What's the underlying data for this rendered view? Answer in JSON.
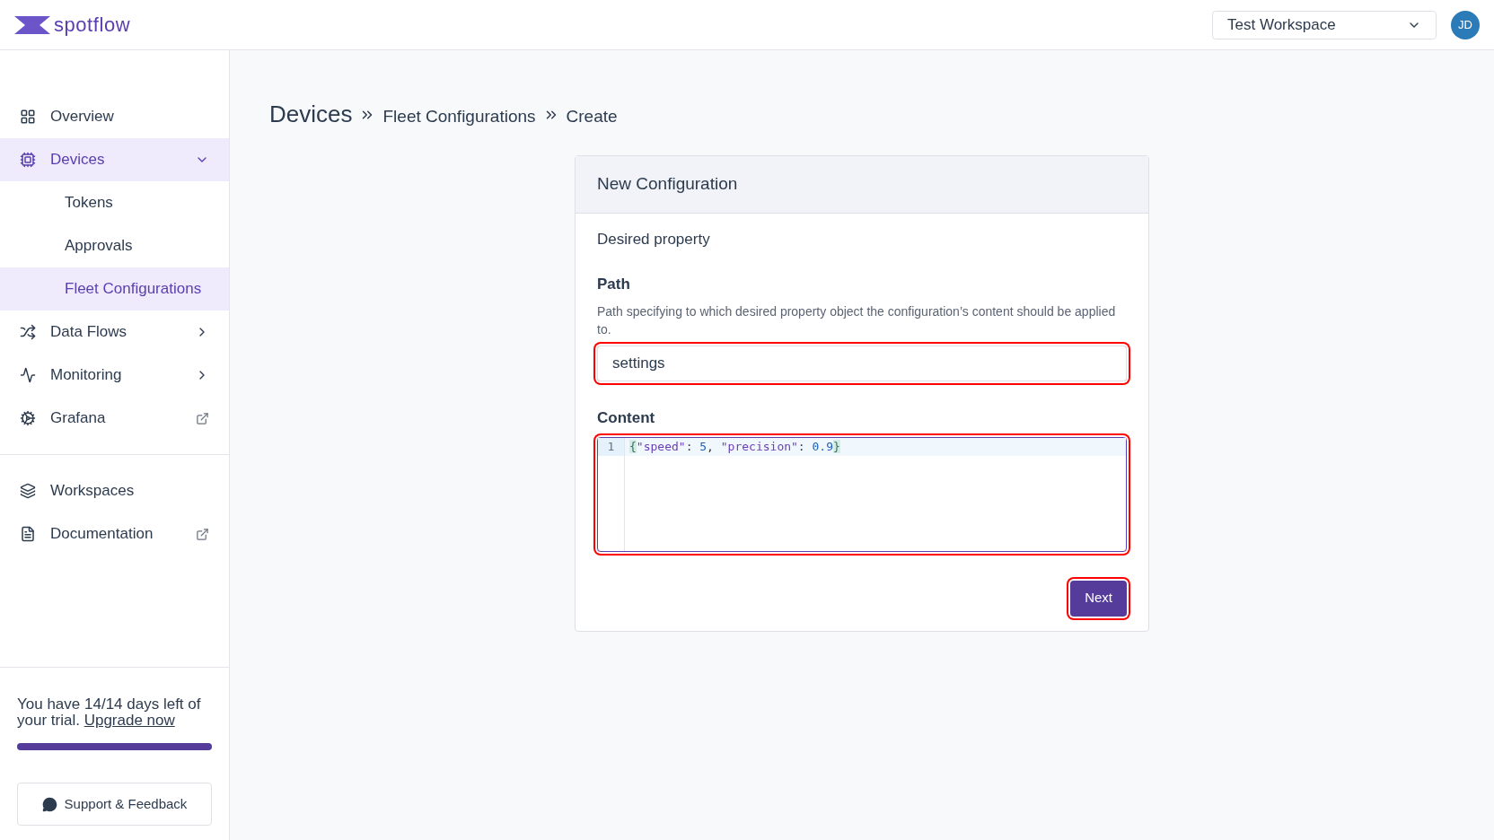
{
  "header": {
    "logo": "spotflow",
    "workspace": "Test Workspace",
    "avatar": "JD"
  },
  "sidebar": {
    "items": [
      {
        "label": "Overview",
        "kind": "link",
        "selected": false
      },
      {
        "label": "Devices",
        "kind": "group",
        "selected": true,
        "expanded": true,
        "children": [
          {
            "label": "Tokens",
            "selected": false
          },
          {
            "label": "Approvals",
            "selected": false
          },
          {
            "label": "Fleet Configurations",
            "selected": true
          }
        ]
      },
      {
        "label": "Data Flows",
        "kind": "group",
        "selected": false,
        "expanded": false
      },
      {
        "label": "Monitoring",
        "kind": "group",
        "selected": false,
        "expanded": false
      },
      {
        "label": "Grafana",
        "kind": "external",
        "selected": false
      }
    ],
    "bottom_items": [
      {
        "label": "Workspaces",
        "kind": "link",
        "selected": false
      },
      {
        "label": "Documentation",
        "kind": "external",
        "selected": false
      }
    ],
    "trial": {
      "text": "You have 14/14 days left of your trial.",
      "link": "Upgrade now",
      "level": 1
    },
    "support": "Support & Feedback"
  },
  "breadcrumb": [
    {
      "label": "Devices"
    },
    {
      "label": "Fleet Configurations"
    },
    {
      "label": "Create"
    }
  ],
  "card": {
    "title": "New Configuration",
    "section": "Desired property",
    "path": {
      "label": "Path",
      "hint": "Path specifying to which desired property object the configuration’s content should be applied to.",
      "value": "settings",
      "highlighted": true
    },
    "content": {
      "label": "Content",
      "highlighted": true,
      "lines": [
        {
          "number": "1",
          "tokens": [
            {
              "text": "{",
              "kind": "bracket"
            },
            {
              "text": "\"speed\"",
              "kind": "key"
            },
            {
              "text": ": ",
              "kind": "punct"
            },
            {
              "text": "5",
              "kind": "number"
            },
            {
              "text": ", ",
              "kind": "punct"
            },
            {
              "text": "\"precision\"",
              "kind": "key"
            },
            {
              "text": ": ",
              "kind": "punct"
            },
            {
              "text": "0.9",
              "kind": "number"
            },
            {
              "text": "}",
              "kind": "bracket"
            }
          ]
        }
      ]
    },
    "next": {
      "label": "Next",
      "highlighted": true
    }
  }
}
